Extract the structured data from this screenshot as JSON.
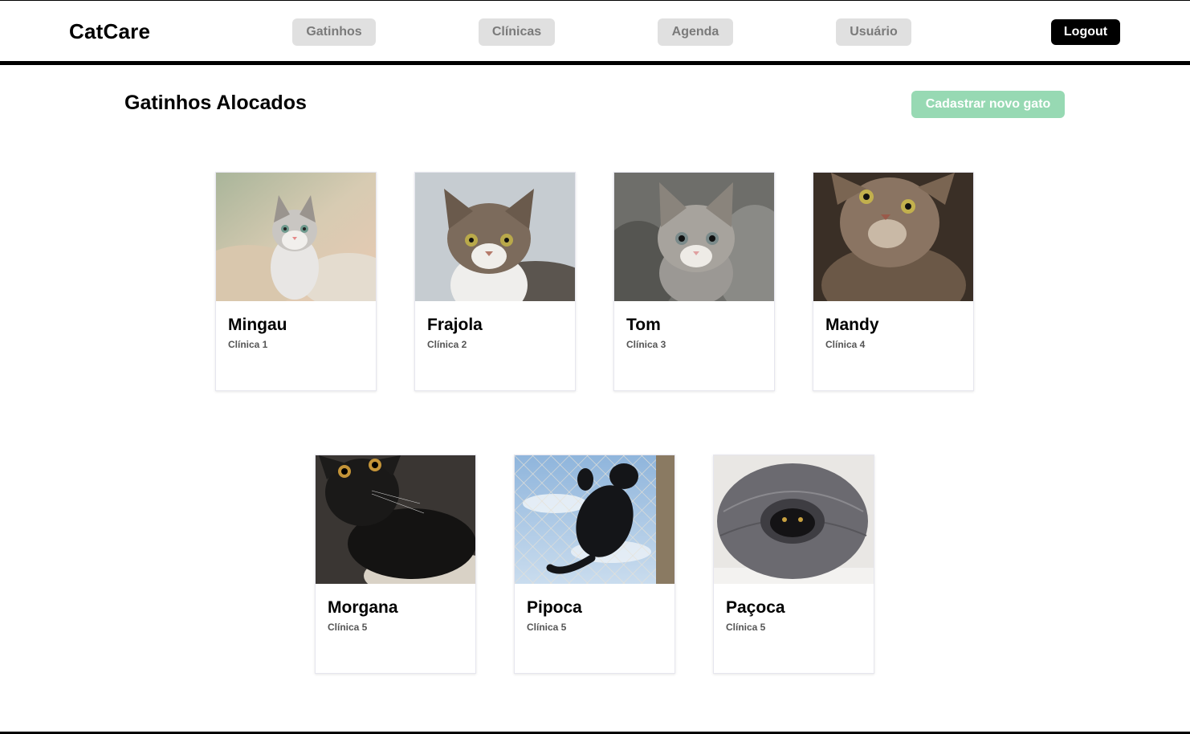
{
  "brand": "CatCare",
  "nav": {
    "gatinhos": "Gatinhos",
    "clinicas": "Clínicas",
    "agenda": "Agenda",
    "usuario": "Usuário",
    "logout": "Logout"
  },
  "main": {
    "title": "Gatinhos Alocados",
    "add_button": "Cadastrar novo gato"
  },
  "cats": [
    {
      "name": "Mingau",
      "clinic": "Clínica 1"
    },
    {
      "name": "Frajola",
      "clinic": "Clínica 2"
    },
    {
      "name": "Tom",
      "clinic": "Clínica 3"
    },
    {
      "name": "Mandy",
      "clinic": "Clínica 4"
    },
    {
      "name": "Morgana",
      "clinic": "Clínica 5"
    },
    {
      "name": "Pipoca",
      "clinic": "Clínica 5"
    },
    {
      "name": "Paçoca",
      "clinic": "Clínica 5"
    }
  ],
  "colors": {
    "nav_button_bg": "#e0e0e0",
    "nav_button_text": "#7a7a7a",
    "logout_bg": "#000000",
    "add_button_bg": "#97d9b3"
  }
}
